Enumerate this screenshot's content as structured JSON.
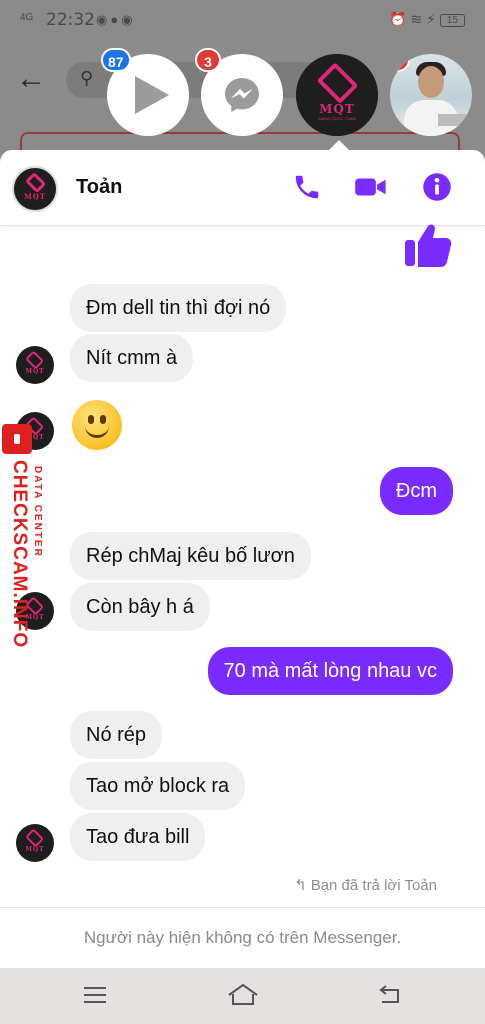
{
  "status_bar": {
    "signal": "4G",
    "time": "22:32",
    "battery": "15"
  },
  "chat_heads": [
    {
      "name": "video-app",
      "badge": "87"
    },
    {
      "name": "messenger",
      "badge": "3"
    },
    {
      "name": "mqt-page",
      "badge": ""
    },
    {
      "name": "contact-photo",
      "badge": "3"
    }
  ],
  "logo": {
    "text": "MQT",
    "subtext": "MANG QUOC TOAN"
  },
  "chat": {
    "contact_name": "Toản",
    "messages": [
      {
        "from": "them",
        "text": "Đm dell tin thì đợi nó"
      },
      {
        "from": "them",
        "text": "Nít cmm à"
      },
      {
        "from": "me",
        "text": "Đcm"
      },
      {
        "from": "them",
        "text": "Rép chMaj kêu bố lươn"
      },
      {
        "from": "them",
        "text": "Còn bây h á"
      },
      {
        "from": "me",
        "text": "70 mà mất lòng nhau vc"
      },
      {
        "from": "them",
        "text": "Nó rép"
      },
      {
        "from": "them",
        "text": "Tao mở block ra"
      },
      {
        "from": "them",
        "text": "Tao đưa bill"
      }
    ],
    "reply_note": "Bạn đã trả lời Toản",
    "footer_notice": "Người này hiện không có trên Messenger."
  },
  "watermark": {
    "main": "CHECKSCAM.INFO",
    "sub": "DATA CENTER"
  },
  "colors": {
    "accent": "#7a2bff",
    "in_bubble": "#efefef",
    "watermark": "#e02020"
  }
}
